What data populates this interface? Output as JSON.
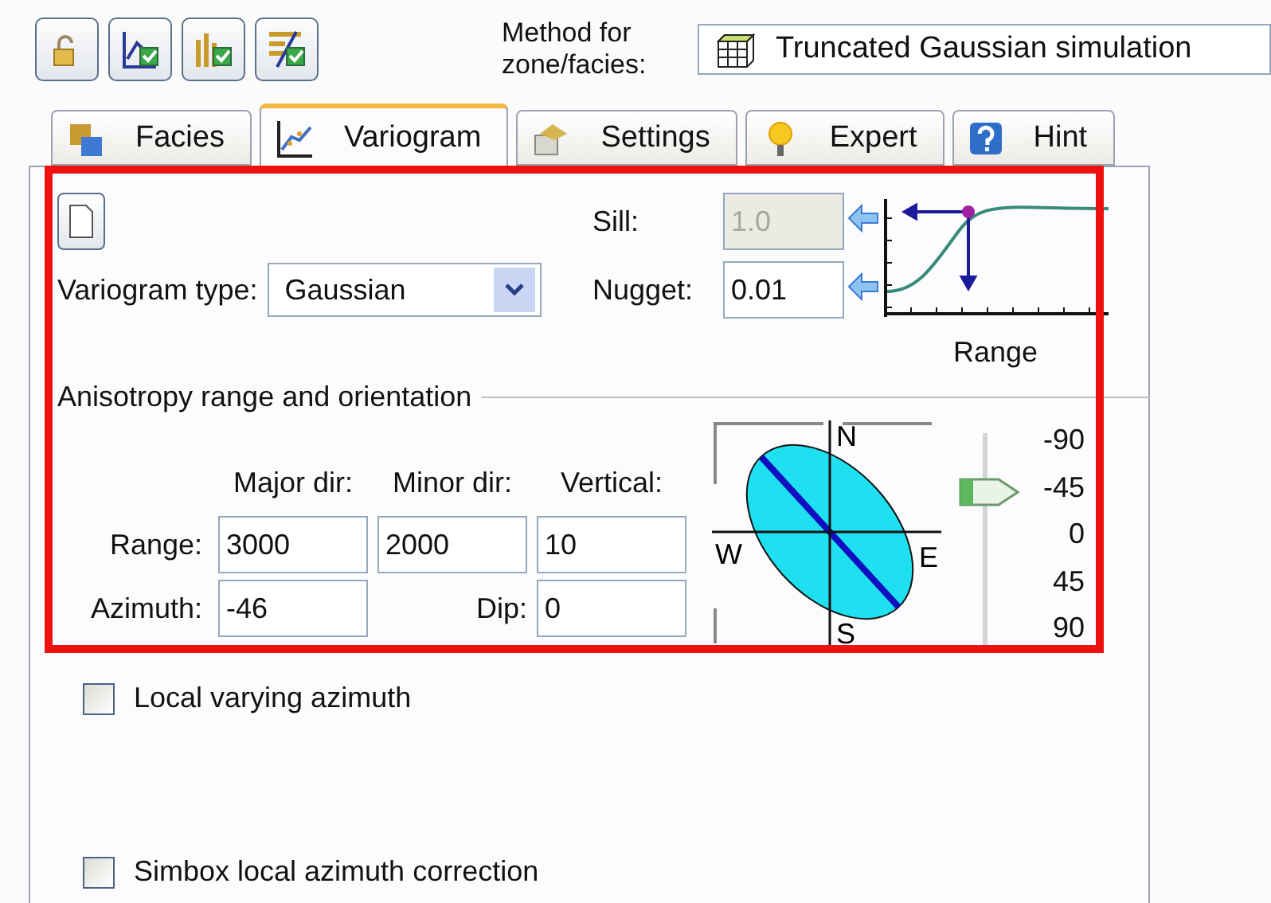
{
  "method": {
    "label": "Method for zone/facies:",
    "value": "Truncated Gaussian simulation"
  },
  "tabs": [
    {
      "label": "Facies",
      "selected": false
    },
    {
      "label": "Variogram",
      "selected": true
    },
    {
      "label": "Settings",
      "selected": false
    },
    {
      "label": "Expert",
      "selected": false
    },
    {
      "label": "Hint",
      "selected": false
    }
  ],
  "variogram": {
    "type_label": "Variogram type:",
    "type_value": "Gaussian",
    "sill": {
      "label": "Sill:",
      "value": "1.0",
      "disabled": true
    },
    "nugget": {
      "label": "Nugget:",
      "value": "0.01",
      "disabled": false
    },
    "chart_label": "Range"
  },
  "anisotropy": {
    "title": "Anisotropy range and orientation",
    "headers": [
      "Major dir:",
      "Minor dir:",
      "Vertical:"
    ],
    "range": {
      "label": "Range:",
      "values": [
        "3000",
        "2000",
        "10"
      ]
    },
    "azimuth": {
      "label": "Azimuth:",
      "value": "-46"
    },
    "dip": {
      "label": "Dip:",
      "value": "0"
    },
    "compass": {
      "north": "N",
      "west": "W",
      "east": "E",
      "south": "S"
    },
    "dip_slider": {
      "ticks": [
        "-90",
        "-45",
        "0",
        "45",
        "90"
      ]
    }
  },
  "options": [
    {
      "label": "Local varying azimuth",
      "checked": false
    },
    {
      "label": "Simbox local azimuth correction",
      "checked": false
    }
  ]
}
